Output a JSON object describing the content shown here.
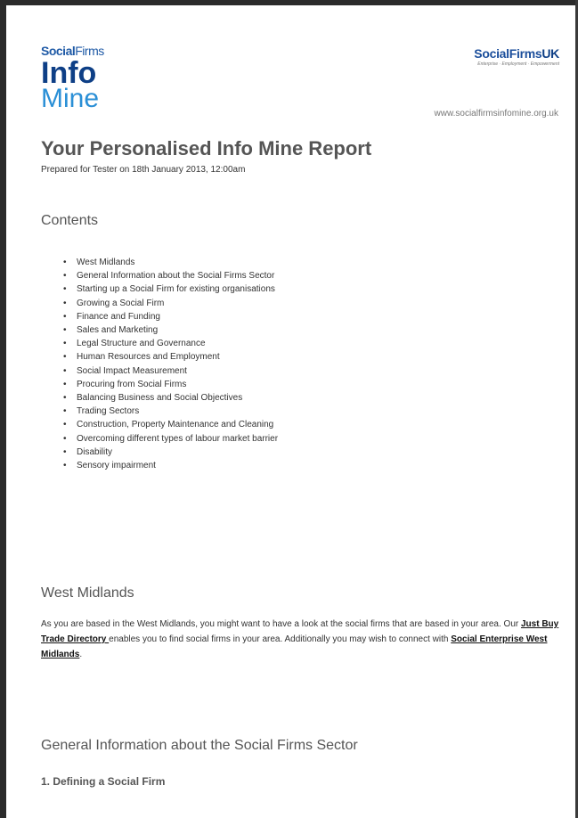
{
  "header": {
    "logo_left_small_social": "Social",
    "logo_left_small_firms": "Firms",
    "logo_left_info": "Info",
    "logo_left_mine": "Mine",
    "logo_right_social": "SocialFirms",
    "logo_right_uk": "UK",
    "logo_right_tagline": "Enterprise · Employment · Empowerment",
    "site_url": "www.socialfirmsinfomine.org.uk"
  },
  "report": {
    "title": "Your Personalised Info Mine Report",
    "prepared": "Prepared for Tester on 18th January 2013, 12:00am"
  },
  "contents": {
    "heading": "Contents",
    "items": [
      "West Midlands",
      "General Information about the Social Firms Sector",
      "Starting up a Social Firm for existing organisations",
      "Growing a Social Firm",
      "Finance and Funding",
      "Sales and Marketing",
      "Legal Structure and Governance",
      "Human Resources and Employment",
      "Social Impact Measurement",
      "Procuring from Social Firms",
      "Balancing Business and Social Objectives",
      "Trading Sectors",
      "Construction, Property Maintenance and Cleaning",
      "Overcoming different types of labour market barrier",
      "Disability",
      "Sensory impairment"
    ]
  },
  "west_midlands": {
    "heading": "West Midlands",
    "text_1": "As you are based in the West Midlands, you might want to have a look at the social firms that are based in your area. Our ",
    "link_1": "Just Buy Trade Directory ",
    "text_2": "enables you to find social firms in your area. Additionally you may wish to connect with ",
    "link_2": "Social Enterprise West Midlands",
    "text_3": "."
  },
  "general_info": {
    "heading": "General Information about the Social Firms Sector",
    "subheading": "1. Defining a Social Firm"
  },
  "colors": {
    "logo_dark_blue": "#0e3f86",
    "logo_light_blue": "#2a8fd6",
    "heading_grey": "#555555"
  }
}
